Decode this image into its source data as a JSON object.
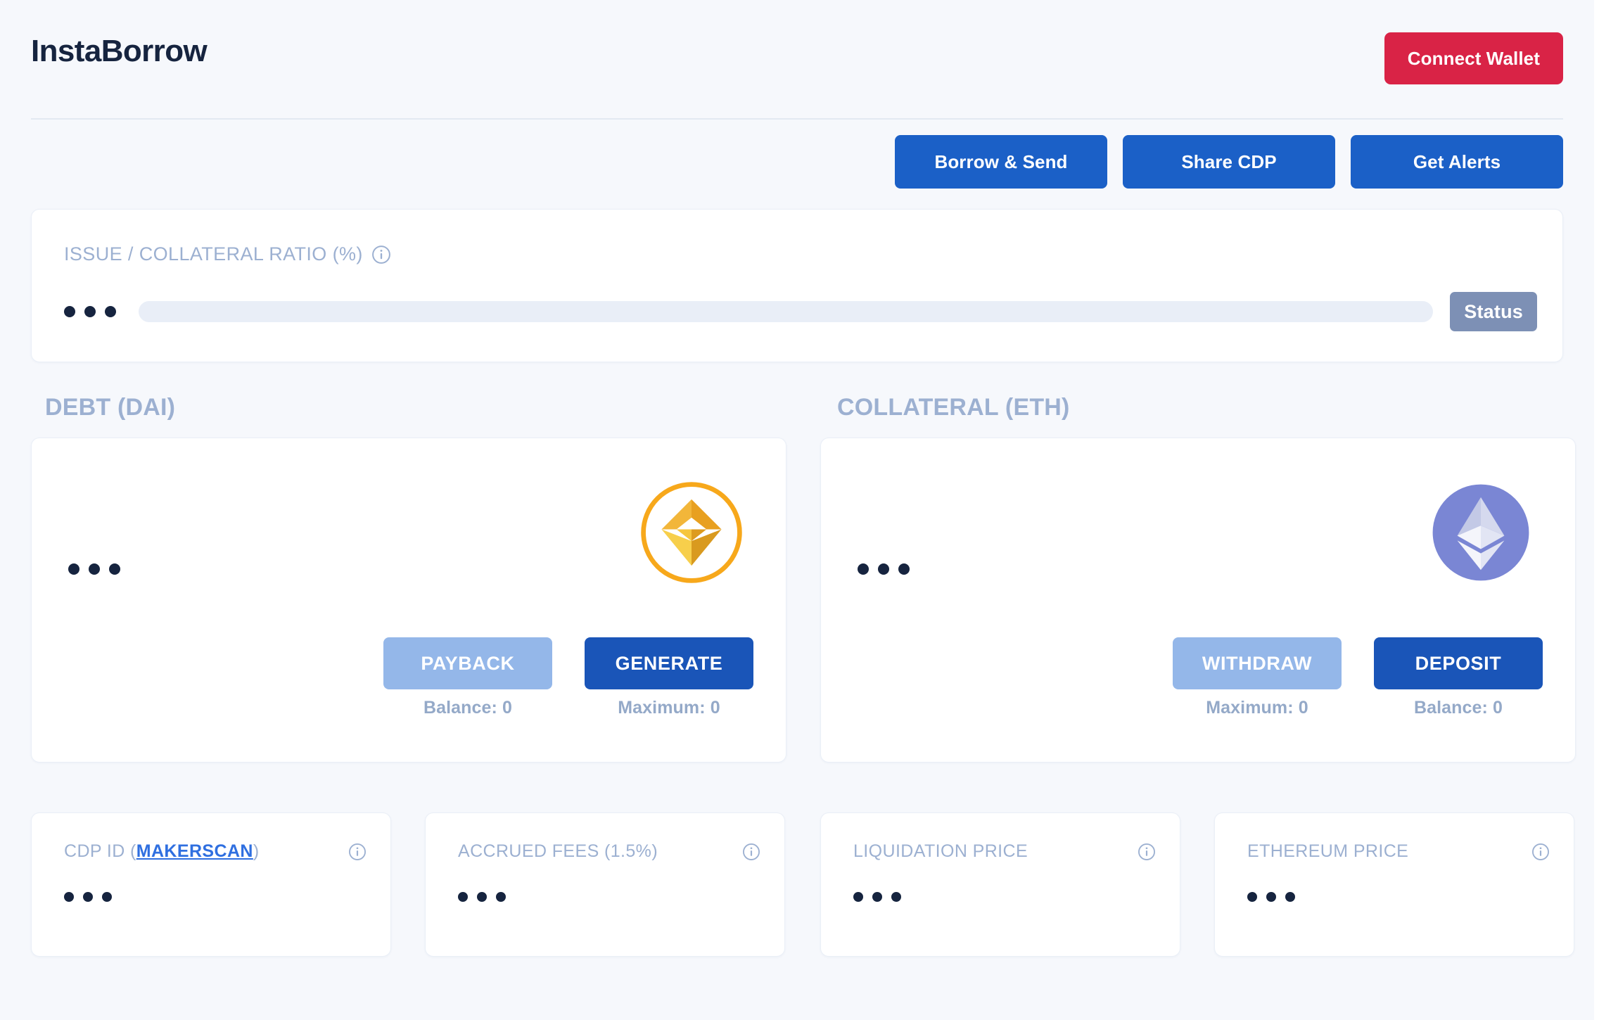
{
  "header": {
    "brand": "InstaBorrow",
    "connect_wallet_label": "Connect Wallet"
  },
  "actions": [
    {
      "label": "Borrow & Send",
      "name": "borrow-and-send"
    },
    {
      "label": "Share CDP",
      "name": "share-cdp"
    },
    {
      "label": "Get Alerts",
      "name": "get-alerts"
    }
  ],
  "ratio": {
    "label": "ISSUE / COLLATERAL RATIO (%)",
    "value": "...",
    "progress_percent": 0,
    "status_label": "Status"
  },
  "debt": {
    "section_title": "DEBT (DAI)",
    "amount": "...",
    "coin": "dai-icon",
    "left_action": {
      "label": "PAYBACK",
      "hint": "Balance: 0"
    },
    "right_action": {
      "label": "GENERATE",
      "hint": "Maximum: 0"
    }
  },
  "collateral": {
    "section_title": "COLLATERAL (ETH)",
    "amount": "...",
    "coin": "eth-icon",
    "left_action": {
      "label": "WITHDRAW",
      "hint": "Maximum: 0"
    },
    "right_action": {
      "label": "DEPOSIT",
      "hint": "Balance: 0"
    }
  },
  "stats": [
    {
      "label_prefix": "CDP ID (",
      "link": "MAKERSCAN",
      "label_suffix": ")",
      "value": "...",
      "name": "cdp-id"
    },
    {
      "label": "ACCRUED FEES (1.5%)",
      "value": "...",
      "name": "accrued-fees"
    },
    {
      "label": "LIQUIDATION PRICE",
      "value": "...",
      "name": "liquidation-price"
    },
    {
      "label": "ETHEREUM PRICE",
      "value": "...",
      "name": "ethereum-price"
    }
  ],
  "colors": {
    "page_bg": "#f6f8fc",
    "brand_text": "#16243f",
    "danger": "#d92346",
    "primary_blue": "#1b60c7",
    "primary_blue_dark": "#1a55b8",
    "secondary_blue": "#94b7e9",
    "muted_label": "#9cb0d1",
    "status_badge": "#7d90b5",
    "track": "#e9eef7",
    "link": "#2f6fe0",
    "dai_orange": "#f5a623",
    "eth_purple": "#7a86d4"
  }
}
